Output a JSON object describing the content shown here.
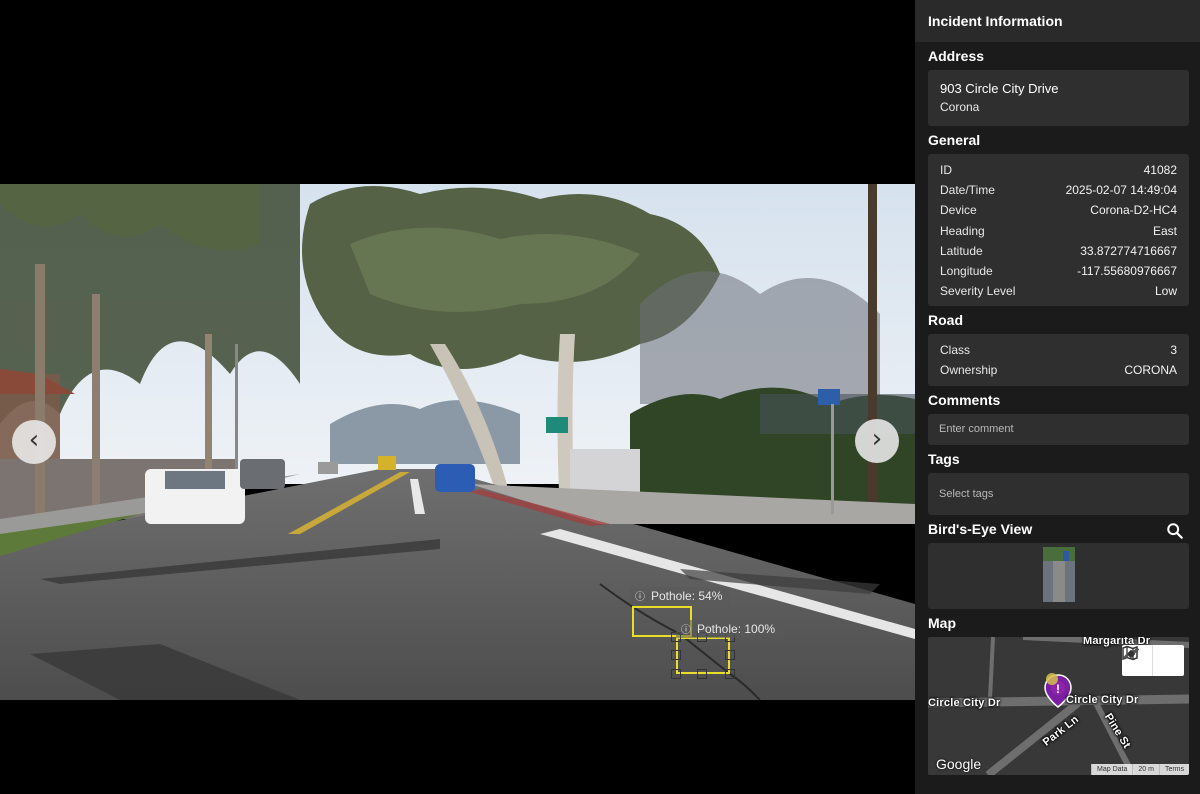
{
  "viewer": {
    "detections": [
      {
        "label": "Pothole: 54%"
      },
      {
        "label": "Pothole: 100%"
      }
    ]
  },
  "sidebar": {
    "title": "Incident Information",
    "address": {
      "heading": "Address",
      "line1": "903 Circle City Drive",
      "line2": "Corona"
    },
    "general": {
      "heading": "General",
      "rows": [
        {
          "key": "ID",
          "value": "41082"
        },
        {
          "key": "Date/Time",
          "value": "2025-02-07 14:49:04"
        },
        {
          "key": "Device",
          "value": "Corona-D2-HC4"
        },
        {
          "key": "Heading",
          "value": "East"
        },
        {
          "key": "Latitude",
          "value": "33.872774716667"
        },
        {
          "key": "Longitude",
          "value": "-117.55680976667"
        },
        {
          "key": "Severity Level",
          "value": "Low"
        }
      ]
    },
    "road": {
      "heading": "Road",
      "rows": [
        {
          "key": "Class",
          "value": "3"
        },
        {
          "key": "Ownership",
          "value": "CORONA"
        }
      ]
    },
    "comments": {
      "heading": "Comments",
      "placeholder": "Enter comment"
    },
    "tags": {
      "heading": "Tags",
      "placeholder": "Select tags"
    },
    "birdseye": {
      "heading": "Bird's-Eye View"
    },
    "map": {
      "heading": "Map",
      "streets": {
        "margarita": "Margarita Dr",
        "circle_left": "Circle City Dr",
        "circle_right": "Circle City Dr",
        "park": "Park Ln",
        "pine": "Pine St"
      },
      "logo": "Google",
      "footer": {
        "data": "Map Data",
        "scale": "20 m",
        "terms": "Terms"
      }
    }
  },
  "colors": {
    "detection_box": "#e8dd28",
    "marker": "#7b1fa2",
    "panel": "#2f2f2f",
    "sidebar_bg": "#1b1b1b"
  },
  "icons": {
    "prev": "chevron-left-icon",
    "next": "chevron-right-icon",
    "search": "search-icon",
    "map_type": "map-icon",
    "satellite": "satellite-icon",
    "marker": "alert-marker-icon"
  }
}
